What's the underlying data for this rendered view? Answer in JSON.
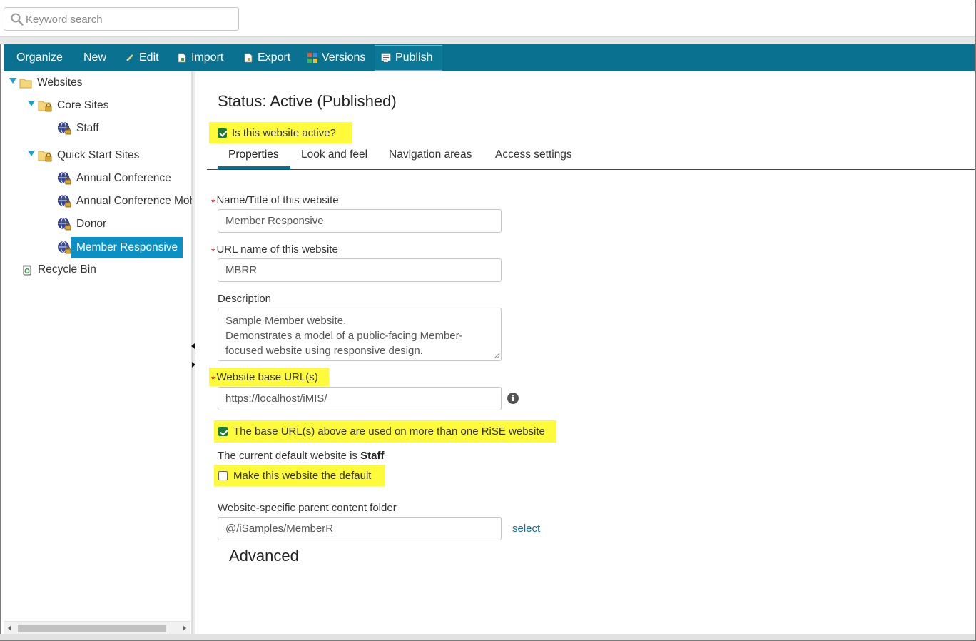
{
  "search": {
    "placeholder": "Keyword search"
  },
  "toolbar": {
    "organize": "Organize",
    "new": "New",
    "edit": "Edit",
    "import": "Import",
    "export": "Export",
    "versions": "Versions",
    "publish": "Publish"
  },
  "tree": {
    "websites": "Websites",
    "core_sites": "Core Sites",
    "staff": "Staff",
    "quick_start_sites": "Quick Start Sites",
    "annual_conference": "Annual Conference",
    "annual_conference_mobile": "Annual Conference Mob",
    "donor": "Donor",
    "member_responsive": "Member Responsive",
    "recycle_bin": "Recycle Bin"
  },
  "main": {
    "status": "Status: Active (Published)",
    "is_active_label": "Is this website active?",
    "is_active_checked": true,
    "tabs": [
      "Properties",
      "Look and feel",
      "Navigation areas",
      "Access settings"
    ],
    "active_tab": "Properties",
    "name_label": "Name/Title of this website",
    "name_value": "Member Responsive",
    "url_name_label": "URL name of this website",
    "url_name_value": "MBRR",
    "description_label": "Description",
    "description_value": "Sample Member website.\nDemonstrates a model of a public-facing Member-focused website using responsive design.",
    "base_url_label": "Website base URL(s)",
    "base_url_value": "https://localhost/iMIS/",
    "base_url_shared_label": "The base URL(s) above are used on more than one RiSE website",
    "base_url_shared_checked": true,
    "current_default_prefix": "The current default website is",
    "current_default_site": "Staff",
    "make_default_label": "Make this website the default",
    "make_default_checked": false,
    "parent_folder_label": "Website-specific parent content folder",
    "parent_folder_value": "@/iSamples/MemberR",
    "select_link": "select",
    "advanced_heading": "Advanced"
  },
  "colors": {
    "toolbar": "#0b7190",
    "selected": "#0a90c5",
    "highlight": "#fffb3a",
    "link": "#1670a8"
  }
}
